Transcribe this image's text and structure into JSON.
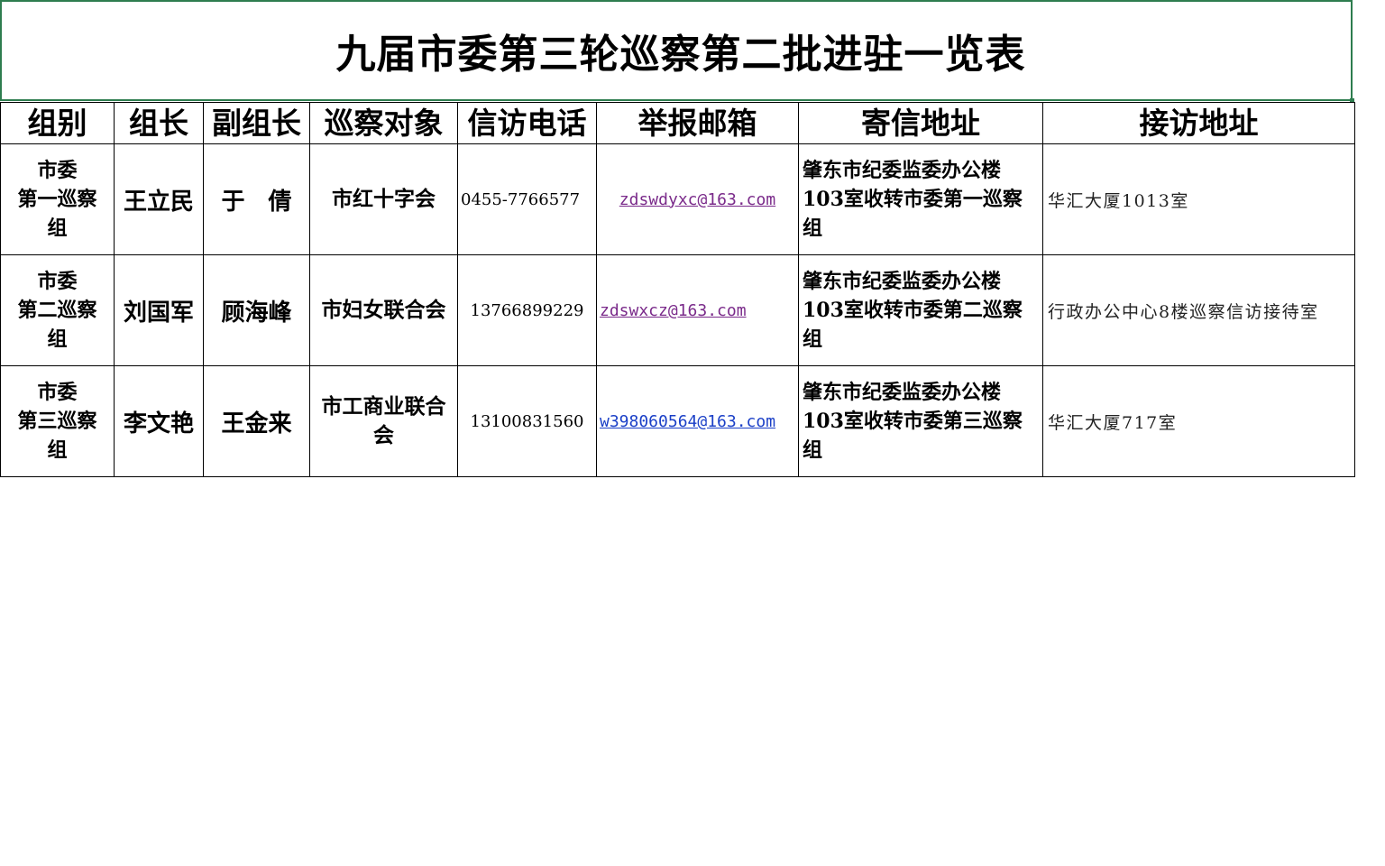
{
  "title": "九届市委第三轮巡察第二批进驻一览表",
  "headers": [
    "组别",
    "组长",
    "副组长",
    "巡察对象",
    "信访电话",
    "举报邮箱",
    "寄信地址",
    "接访地址"
  ],
  "rows": [
    {
      "group_line1": "市委",
      "group_line2": "第一巡察",
      "group_line3": "组",
      "leader": "王立民",
      "deputy": "于　倩",
      "target": "市红十字会",
      "phone": "0455-7766577",
      "email": "zdswdyxc@163.com",
      "mail_line1": "肇东市纪委监委办公楼",
      "mail_line2": "103室收转市委第一巡察",
      "mail_line3": "组",
      "visit": "华汇大厦1013室"
    },
    {
      "group_line1": "市委",
      "group_line2": "第二巡察",
      "group_line3": "组",
      "leader": "刘国军",
      "deputy": "顾海峰",
      "target": "市妇女联合会",
      "phone": "13766899229",
      "email": " zdswxcz@163.com",
      "mail_line1": "肇东市纪委监委办公楼",
      "mail_line2": "103室收转市委第二巡察",
      "mail_line3": "组",
      "visit": "行政办公中心8楼巡察信访接待室"
    },
    {
      "group_line1": "市委",
      "group_line2": "第三巡察",
      "group_line3": "组",
      "leader": "李文艳",
      "deputy": "王金来",
      "target": "市工商业联合会",
      "phone": "13100831560",
      "email": "w398060564@163.com",
      "mail_line1": "肇东市纪委监委办公楼",
      "mail_line2": "103室收转市委第三巡察",
      "mail_line3": "组",
      "visit": "华汇大厦717室"
    }
  ]
}
